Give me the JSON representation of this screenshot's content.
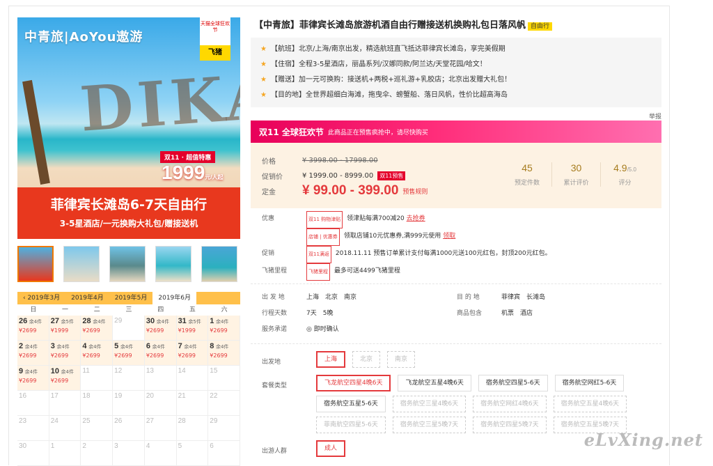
{
  "hero": {
    "logo": "中青旅|AoYou遨游",
    "tmall_badge": "天猫全球狂欢节",
    "fliggy": "飞猪",
    "sign_letters": "DIKA",
    "promo_tag": "双11 · 超值特惠",
    "price": "1999",
    "price_unit": "元/人起",
    "title": "菲律宾长滩岛6-7天自由行",
    "subtitle": "3-5星酒店/一元换购大礼包/赠接送机"
  },
  "thumbs": [
    "thumb-1",
    "thumb-2",
    "thumb-3",
    "thumb-4",
    "thumb-5"
  ],
  "calendar": {
    "tabs": [
      "‹ 2019年3月",
      "2019年4月",
      "2019年5月",
      "2019年6月"
    ],
    "active_tab": 3,
    "weekdays": [
      "日",
      "一",
      "二",
      "三",
      "四",
      "五",
      "六"
    ],
    "days": [
      {
        "d": "26",
        "s": "余4件",
        "p": "¥2699"
      },
      {
        "d": "27",
        "s": "余5件",
        "p": "¥1999"
      },
      {
        "d": "28",
        "s": "余4件",
        "p": "¥2699"
      },
      {
        "d": "29",
        "s": "",
        "p": ""
      },
      {
        "d": "30",
        "s": "余4件",
        "p": "¥2699"
      },
      {
        "d": "31",
        "s": "余5件",
        "p": "¥1999"
      },
      {
        "d": "1",
        "s": "余4件",
        "p": "¥2699"
      },
      {
        "d": "2",
        "s": "余4件",
        "p": "¥2699"
      },
      {
        "d": "3",
        "s": "余4件",
        "p": "¥2699"
      },
      {
        "d": "4",
        "s": "余4件",
        "p": "¥2699"
      },
      {
        "d": "5",
        "s": "余4件",
        "p": "¥2699"
      },
      {
        "d": "6",
        "s": "余4件",
        "p": "¥2699"
      },
      {
        "d": "7",
        "s": "余4件",
        "p": "¥2699"
      },
      {
        "d": "8",
        "s": "余4件",
        "p": "¥2699"
      },
      {
        "d": "9",
        "s": "余4件",
        "p": "¥2699"
      },
      {
        "d": "10",
        "s": "余4件",
        "p": "¥2699"
      },
      {
        "d": "11",
        "s": "",
        "p": ""
      },
      {
        "d": "12",
        "s": "",
        "p": ""
      },
      {
        "d": "13",
        "s": "",
        "p": ""
      },
      {
        "d": "14",
        "s": "",
        "p": ""
      },
      {
        "d": "15",
        "s": "",
        "p": ""
      },
      {
        "d": "16",
        "s": "",
        "p": ""
      },
      {
        "d": "17",
        "s": "",
        "p": ""
      },
      {
        "d": "18",
        "s": "",
        "p": ""
      },
      {
        "d": "19",
        "s": "",
        "p": ""
      },
      {
        "d": "20",
        "s": "",
        "p": ""
      },
      {
        "d": "21",
        "s": "",
        "p": ""
      },
      {
        "d": "22",
        "s": "",
        "p": ""
      },
      {
        "d": "23",
        "s": "",
        "p": ""
      },
      {
        "d": "24",
        "s": "",
        "p": ""
      },
      {
        "d": "25",
        "s": "",
        "p": ""
      },
      {
        "d": "26",
        "s": "",
        "p": ""
      },
      {
        "d": "27",
        "s": "",
        "p": ""
      },
      {
        "d": "28",
        "s": "",
        "p": ""
      },
      {
        "d": "29",
        "s": "",
        "p": ""
      },
      {
        "d": "30",
        "s": "",
        "p": ""
      },
      {
        "d": "1",
        "s": "",
        "p": ""
      },
      {
        "d": "2",
        "s": "",
        "p": ""
      },
      {
        "d": "3",
        "s": "",
        "p": ""
      },
      {
        "d": "4",
        "s": "",
        "p": ""
      },
      {
        "d": "5",
        "s": "",
        "p": ""
      },
      {
        "d": "6",
        "s": "",
        "p": ""
      }
    ]
  },
  "product": {
    "title": "【中青旅】菲律宾长滩岛旅游机酒自由行赠接送机换购礼包日落风帆",
    "tag": "自由行",
    "features": [
      "【航班】北京/上海/南京出发，精选航班直飞抵达菲律宾长滩岛，享完美假期",
      "【住宿】全程3-5星酒店，丽晶系列/汉娜同款/阿兰达/天堂花园/哈文！",
      "【赠送】加一元可换购：接送机+两税+巡礼游+乳胶店；北京出发赠大礼包！",
      "【目的地】全世界超细白海滩，拖曳伞、螃蟹船、落日风帆，性价比超高海岛"
    ],
    "report": "举报"
  },
  "promo_bar": {
    "brand": "双11 全球狂欢节",
    "text": "此商品正在预售疯抢中，请尽快购买"
  },
  "price": {
    "label_price": "价格",
    "original": "¥ 3998.00 - 17998.00",
    "label_promo": "促销价",
    "promo": "¥ 1999.00 - 8999.00",
    "promo_badge": "双11预售",
    "label_deposit": "定金",
    "deposit": "¥ 99.00 - 399.00",
    "deposit_rule": "预售规则",
    "stats": [
      {
        "v": "45",
        "k": "预定件数"
      },
      {
        "v": "30",
        "k": "累计评价"
      },
      {
        "v": "4.9",
        "suffix": "/5.0",
        "k": "评分"
      }
    ]
  },
  "discounts": {
    "label_offer": "优惠",
    "offer1_chip": "双11 购物津贴",
    "offer1": "领津贴每满700减20",
    "offer1_link": "去抢券",
    "offer2_chip": "店铺 | 优惠券",
    "offer2": "领取店铺10元优惠券,满999元使用",
    "offer2_link": "领取",
    "label_promo": "促销",
    "promo_chip": "双11满返",
    "promo_text": "2018.11.11 预售订单累计支付每满1000元送100元红包，封顶200元红包。",
    "label_miles": "飞猪里程",
    "miles_chip": "飞猪里程",
    "miles_text": "最多可送4499飞猪里程"
  },
  "info": {
    "depart_label": "出 发 地",
    "depart": "上海　北京　南京",
    "dest_label": "目 的 地",
    "dest": "菲律宾　长滩岛",
    "days_label": "行程天数",
    "days": "7天　5晚",
    "pack_label": "商品包含",
    "pack": "机票　酒店",
    "service_label": "服务承诺",
    "service": "即时确认"
  },
  "options": {
    "depart_label": "出发地",
    "departs": [
      {
        "t": "上海",
        "st": "sel"
      },
      {
        "t": "北京",
        "st": "dis"
      },
      {
        "t": "南京",
        "st": "dis"
      }
    ],
    "pkg_label": "套餐类型",
    "pkgs": [
      {
        "t": "飞龙航空四星4晚6天",
        "st": "sel"
      },
      {
        "t": "飞龙航空五星4晚6天",
        "st": ""
      },
      {
        "t": "宿务航空四星5-6天",
        "st": ""
      },
      {
        "t": "宿务航空网红5-6天",
        "st": ""
      },
      {
        "t": "宿务航空五星5-6天",
        "st": ""
      },
      {
        "t": "宿务航空三星4晚6天",
        "st": "dis"
      },
      {
        "t": "宿务航空网红4晚6天",
        "st": "dis"
      },
      {
        "t": "宿务航空五星4晚6天",
        "st": "dis"
      },
      {
        "t": "菲南航空四星5-6天",
        "st": "dis"
      },
      {
        "t": "宿务航空三星5晚7天",
        "st": "dis"
      },
      {
        "t": "宿务航空四星5晚7天",
        "st": "dis"
      },
      {
        "t": "宿务航空五星5晚7天",
        "st": "dis"
      }
    ],
    "crowd_label": "出游人群",
    "crowds": [
      {
        "t": "成人",
        "st": "sel"
      }
    ]
  },
  "watermark": "eLvXing.net"
}
